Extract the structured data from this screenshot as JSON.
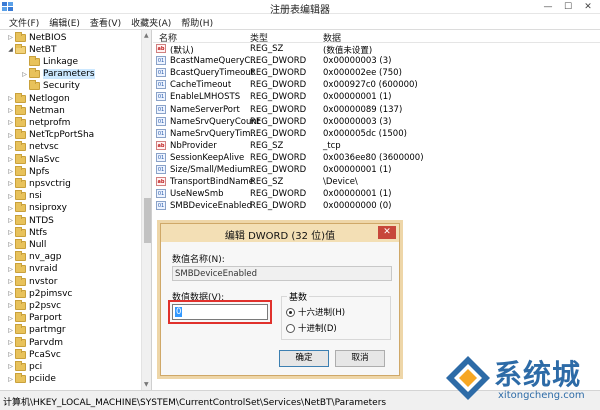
{
  "window": {
    "title": "注册表编辑器",
    "minimize": "—",
    "maximize": "☐",
    "close": "✕"
  },
  "menu": [
    "文件(F)",
    "编辑(E)",
    "查看(V)",
    "收藏夹(A)",
    "帮助(H)"
  ],
  "tree": {
    "items": [
      {
        "label": "NetBIOS",
        "indent": 4,
        "expander": "▷",
        "open": false
      },
      {
        "label": "NetBT",
        "indent": 4,
        "expander": "◢",
        "open": true
      },
      {
        "label": "Linkage",
        "indent": 5,
        "expander": "",
        "open": false
      },
      {
        "label": "Parameters",
        "indent": 5,
        "expander": "▷",
        "open": false,
        "selected": true
      },
      {
        "label": "Security",
        "indent": 5,
        "expander": "",
        "open": false
      },
      {
        "label": "Netlogon",
        "indent": 4,
        "expander": "▷",
        "open": false
      },
      {
        "label": "Netman",
        "indent": 4,
        "expander": "▷",
        "open": false
      },
      {
        "label": "netprofm",
        "indent": 4,
        "expander": "▷",
        "open": false
      },
      {
        "label": "NetTcpPortSha",
        "indent": 4,
        "expander": "▷",
        "open": false
      },
      {
        "label": "netvsc",
        "indent": 4,
        "expander": "▷",
        "open": false
      },
      {
        "label": "NlaSvc",
        "indent": 4,
        "expander": "▷",
        "open": false
      },
      {
        "label": "Npfs",
        "indent": 4,
        "expander": "▷",
        "open": false
      },
      {
        "label": "npsvctrig",
        "indent": 4,
        "expander": "▷",
        "open": false
      },
      {
        "label": "nsi",
        "indent": 4,
        "expander": "▷",
        "open": false
      },
      {
        "label": "nsiproxy",
        "indent": 4,
        "expander": "▷",
        "open": false
      },
      {
        "label": "NTDS",
        "indent": 4,
        "expander": "▷",
        "open": false
      },
      {
        "label": "Ntfs",
        "indent": 4,
        "expander": "▷",
        "open": false
      },
      {
        "label": "Null",
        "indent": 4,
        "expander": "▷",
        "open": false
      },
      {
        "label": "nv_agp",
        "indent": 4,
        "expander": "▷",
        "open": false
      },
      {
        "label": "nvraid",
        "indent": 4,
        "expander": "▷",
        "open": false
      },
      {
        "label": "nvstor",
        "indent": 4,
        "expander": "▷",
        "open": false
      },
      {
        "label": "p2pimsvc",
        "indent": 4,
        "expander": "▷",
        "open": false
      },
      {
        "label": "p2psvc",
        "indent": 4,
        "expander": "▷",
        "open": false
      },
      {
        "label": "Parport",
        "indent": 4,
        "expander": "▷",
        "open": false
      },
      {
        "label": "partmgr",
        "indent": 4,
        "expander": "▷",
        "open": false
      },
      {
        "label": "Parvdm",
        "indent": 4,
        "expander": "▷",
        "open": false
      },
      {
        "label": "PcaSvc",
        "indent": 4,
        "expander": "▷",
        "open": false
      },
      {
        "label": "pci",
        "indent": 4,
        "expander": "▷",
        "open": false
      },
      {
        "label": "pciide",
        "indent": 4,
        "expander": "▷",
        "open": false
      }
    ]
  },
  "list": {
    "columns": [
      "名称",
      "类型",
      "数据"
    ],
    "rows": [
      {
        "icon": "ab",
        "name": "(默认)",
        "type": "REG_SZ",
        "data": "(数值未设置)"
      },
      {
        "icon": "bin",
        "name": "BcastNameQueryC...",
        "type": "REG_DWORD",
        "data": "0x00000003 (3)"
      },
      {
        "icon": "bin",
        "name": "BcastQueryTimeout",
        "type": "REG_DWORD",
        "data": "0x000002ee (750)"
      },
      {
        "icon": "bin",
        "name": "CacheTimeout",
        "type": "REG_DWORD",
        "data": "0x000927c0 (600000)"
      },
      {
        "icon": "bin",
        "name": "EnableLMHOSTS",
        "type": "REG_DWORD",
        "data": "0x00000001 (1)"
      },
      {
        "icon": "bin",
        "name": "NameServerPort",
        "type": "REG_DWORD",
        "data": "0x00000089 (137)"
      },
      {
        "icon": "bin",
        "name": "NameSrvQueryCount",
        "type": "REG_DWORD",
        "data": "0x00000003 (3)"
      },
      {
        "icon": "bin",
        "name": "NameSrvQueryTim...",
        "type": "REG_DWORD",
        "data": "0x000005dc (1500)"
      },
      {
        "icon": "ab",
        "name": "NbProvider",
        "type": "REG_SZ",
        "data": "_tcp"
      },
      {
        "icon": "bin",
        "name": "SessionKeepAlive",
        "type": "REG_DWORD",
        "data": "0x0036ee80 (3600000)"
      },
      {
        "icon": "bin",
        "name": "Size/Small/Medium...",
        "type": "REG_DWORD",
        "data": "0x00000001 (1)"
      },
      {
        "icon": "ab",
        "name": "TransportBindName",
        "type": "REG_SZ",
        "data": "\\Device\\"
      },
      {
        "icon": "bin",
        "name": "UseNewSmb",
        "type": "REG_DWORD",
        "data": "0x00000001 (1)"
      },
      {
        "icon": "bin",
        "name": "SMBDeviceEnabled",
        "type": "REG_DWORD",
        "data": "0x00000000 (0)"
      }
    ]
  },
  "status": "计算机\\HKEY_LOCAL_MACHINE\\SYSTEM\\CurrentControlSet\\Services\\NetBT\\Parameters",
  "dialog": {
    "title": "编辑 DWORD (32 位)值",
    "name_label": "数值名称(N):",
    "name_value": "SMBDeviceEnabled",
    "data_label": "数值数据(V):",
    "data_value": "0",
    "base_label": "基数",
    "radio_hex": "十六进制(H)",
    "radio_dec": "十进制(D)",
    "ok": "确定",
    "cancel": "取消"
  },
  "watermark": {
    "brand": "系统城",
    "url": "xitongcheng.com"
  }
}
